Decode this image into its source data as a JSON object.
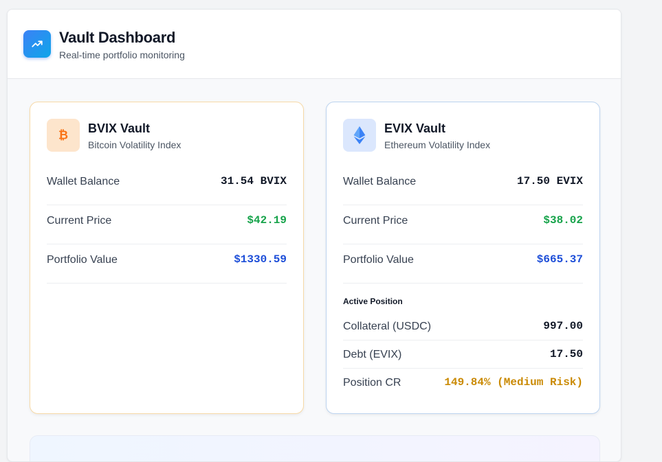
{
  "header": {
    "title": "Vault Dashboard",
    "subtitle": "Real-time portfolio monitoring",
    "logo_icon": "trending-up-icon"
  },
  "vaults": [
    {
      "name": "BVIX Vault",
      "subtitle": "Bitcoin Volatility Index",
      "icon": "bitcoin-icon",
      "accent": "#f97316",
      "rows": [
        {
          "label": "Wallet Balance",
          "value": "31.54 BVIX"
        },
        {
          "label": "Current Price",
          "value": "$42.19"
        },
        {
          "label": "Portfolio Value",
          "value": "$1330.59"
        }
      ]
    },
    {
      "name": "EVIX Vault",
      "subtitle": "Ethereum Volatility Index",
      "icon": "ethereum-icon",
      "accent": "#3b82f6",
      "rows": [
        {
          "label": "Wallet Balance",
          "value": "17.50 EVIX"
        },
        {
          "label": "Current Price",
          "value": "$38.02"
        },
        {
          "label": "Portfolio Value",
          "value": "$665.37"
        }
      ],
      "position": {
        "title": "Active Position",
        "rows": [
          {
            "label": "Collateral (USDC)",
            "value": "997.00"
          },
          {
            "label": "Debt (EVIX)",
            "value": "17.50"
          },
          {
            "label": "Position CR",
            "value": "149.84% (Medium Risk)"
          }
        ]
      }
    }
  ],
  "colors": {
    "price": "#16a34a",
    "portfolio": "#1d4ed8",
    "risk_medium": "#ca8a04"
  }
}
